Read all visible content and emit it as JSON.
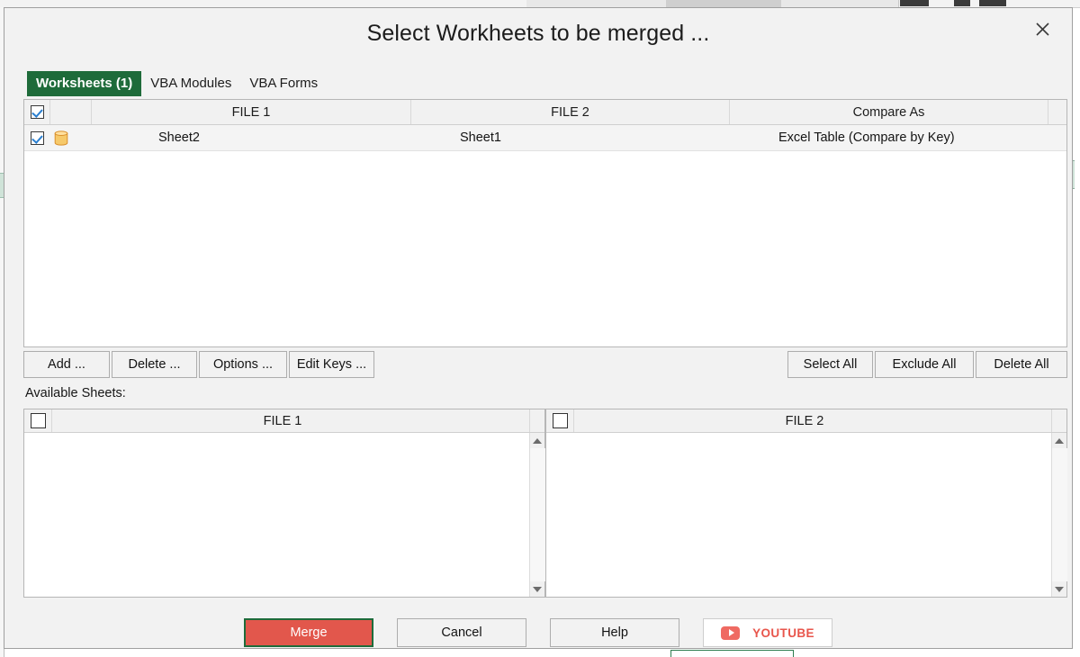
{
  "dialog": {
    "title": "Select Workheets to be merged ...",
    "close_icon": "close-icon"
  },
  "tabs": [
    {
      "label": "Worksheets (1)",
      "active": true
    },
    {
      "label": "VBA Modules",
      "active": false
    },
    {
      "label": "VBA Forms",
      "active": false
    }
  ],
  "grid": {
    "headers": {
      "select_all_checkbox": "checked",
      "file1": "FILE 1",
      "file2": "FILE 2",
      "compare_as": "Compare As"
    },
    "rows": [
      {
        "checked": true,
        "icon": "table-cylinder-icon",
        "file1": "Sheet2",
        "file2": "Sheet1",
        "compare_as": "Excel Table (Compare by Key)"
      }
    ]
  },
  "actions": {
    "add": "Add ...",
    "delete": "Delete ...",
    "options": "Options ...",
    "edit_keys": "Edit Keys ...",
    "select_all": "Select All",
    "exclude_all": "Exclude All",
    "delete_all": "Delete All"
  },
  "available": {
    "label": "Available Sheets:",
    "panels": [
      {
        "title": "FILE 1",
        "checked": false,
        "items": []
      },
      {
        "title": "FILE 2",
        "checked": false,
        "items": []
      }
    ]
  },
  "footer": {
    "merge": "Merge",
    "cancel": "Cancel",
    "help": "Help",
    "youtube": "YOUTUBE"
  },
  "colors": {
    "tab_active_bg": "#1e6b3a",
    "merge_bg": "#e2574c",
    "merge_border": "#1e6b3a",
    "youtube_red": "#e8564c",
    "checkbox_check": "#2a7fd0",
    "table_icon": "#f2b957",
    "dialog_bg": "#f2f2f2"
  }
}
